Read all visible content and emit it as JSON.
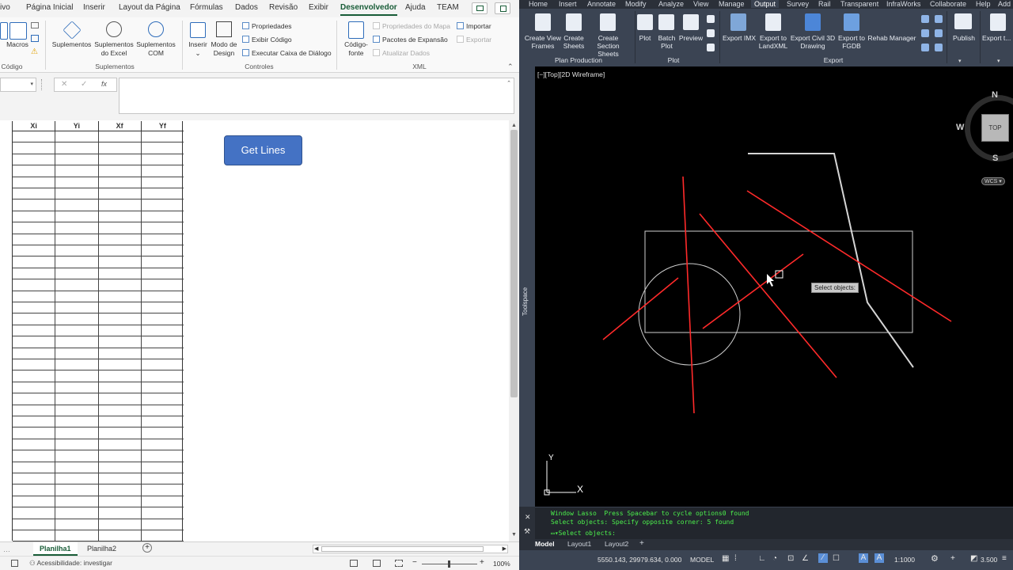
{
  "excel": {
    "tabs": [
      "ivo",
      "Página Inicial",
      "Inserir",
      "Layout da Página",
      "Fórmulas",
      "Dados",
      "Revisão",
      "Exibir",
      "Desenvolvedor",
      "Ajuda",
      "TEAM"
    ],
    "active_tab": "Desenvolvedor",
    "ribbon": {
      "macros": "Macros",
      "codigo_group": "Código",
      "suplementos": "Suplementos",
      "suplementos_excel": [
        "Suplementos",
        "do Excel"
      ],
      "suplementos_com": [
        "Suplementos",
        "COM"
      ],
      "suplementos_group": "Suplementos",
      "inserir": "Inserir",
      "modo_design": [
        "Modo de",
        "Design"
      ],
      "propriedades": "Propriedades",
      "exibir_codigo": "Exibir Código",
      "executar_caixa": "Executar Caixa de Diálogo",
      "controles_group": "Controles",
      "codigo_fonte": [
        "Código-",
        "fonte"
      ],
      "prop_mapa": "Propriedades do Mapa",
      "pacotes": "Pacotes de Expansão",
      "atualizar": "Atualizar Dados",
      "importar": "Importar",
      "exportar": "Exportar",
      "xml_group": "XML"
    },
    "formula_bar": {
      "fx": "fx",
      "cancel": "✕",
      "enter": "✓"
    },
    "columns": [
      "Xi",
      "Yi",
      "Xf",
      "Yf"
    ],
    "button_label": "Get Lines",
    "sheets": [
      "Planilha1",
      "Planilha2"
    ],
    "active_sheet": "Planilha1",
    "status": "Acessibilidade: investigar",
    "zoom": "100%"
  },
  "acad": {
    "tabs": [
      "Home",
      "Insert",
      "Annotate",
      "Modify",
      "Analyze",
      "View",
      "Manage",
      "Output",
      "Survey",
      "Rail",
      "Transparent",
      "InfraWorks",
      "Collaborate",
      "Help",
      "Add"
    ],
    "active_tab": "Output",
    "ribbon": {
      "create_view_frames": [
        "Create View",
        "Frames"
      ],
      "create_sheets": [
        "Create",
        "Sheets"
      ],
      "create_section_sheets": [
        "Create",
        "Section Sheets"
      ],
      "plan_production": "Plan Production",
      "plot": "Plot",
      "batch_plot": [
        "Batch",
        "Plot"
      ],
      "preview": "Preview",
      "plot_group": "Plot",
      "export_imx": "Export IMX",
      "export_landxml": [
        "Export to",
        "LandXML"
      ],
      "export_civil3d": [
        "Export Civil 3D",
        "Drawing"
      ],
      "export_fgdb": [
        "Export to",
        "FGDB"
      ],
      "rehab_manager": "Rehab Manager",
      "export_group": "Export",
      "publish": "Publish",
      "export_t": "Export t..."
    },
    "viewport_label": "[−][Top][2D Wireframe]",
    "toolspace": "Toolspace",
    "viewcube": {
      "n": "N",
      "s": "S",
      "w": "W",
      "top": "TOP",
      "wcs": "WCS"
    },
    "tooltip": "Select objects:",
    "ucs": {
      "x": "X",
      "y": "Y"
    },
    "command_lines": [
      "Window Lasso  Press Spacebar to cycle options0 found",
      "Select objects: Specify opposite corner: 5 found"
    ],
    "command_prompt": "Select objects:",
    "layout_tabs": [
      "Model",
      "Layout1",
      "Layout2"
    ],
    "active_layout": "Model",
    "coordinates": "5550.143, 29979.634, 0.000",
    "model_label": "MODEL",
    "scale": "1:1000",
    "annotation_value": "3.500"
  }
}
